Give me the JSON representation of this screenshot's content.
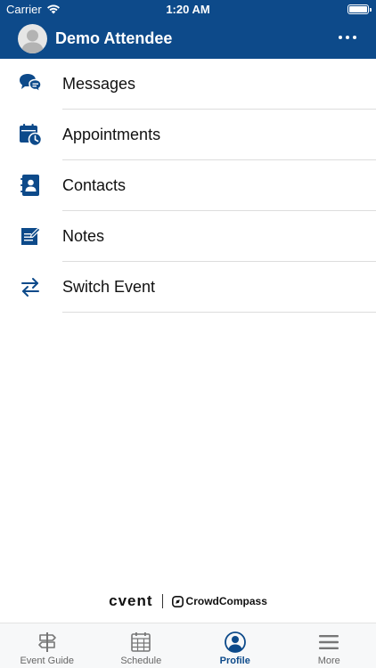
{
  "status_bar": {
    "carrier": "Carrier",
    "time": "1:20 AM"
  },
  "header": {
    "user_name": "Demo Attendee"
  },
  "menu": [
    {
      "label": "Messages",
      "icon": "messages-icon"
    },
    {
      "label": "Appointments",
      "icon": "appointments-calendar-icon"
    },
    {
      "label": "Contacts",
      "icon": "contacts-book-icon"
    },
    {
      "label": "Notes",
      "icon": "notes-icon"
    },
    {
      "label": "Switch Event",
      "icon": "switch-arrows-icon"
    }
  ],
  "branding": {
    "primary": "cvent",
    "secondary": "CrowdCompass"
  },
  "tabs": [
    {
      "label": "Event Guide",
      "icon": "signpost-icon"
    },
    {
      "label": "Schedule",
      "icon": "calendar-grid-icon"
    },
    {
      "label": "Profile",
      "icon": "profile-icon",
      "active": true
    },
    {
      "label": "More",
      "icon": "hamburger-icon"
    }
  ],
  "colors": {
    "brand": "#0d4a8a",
    "background": "#ffffff",
    "tabbar": "#f7f8f9"
  }
}
